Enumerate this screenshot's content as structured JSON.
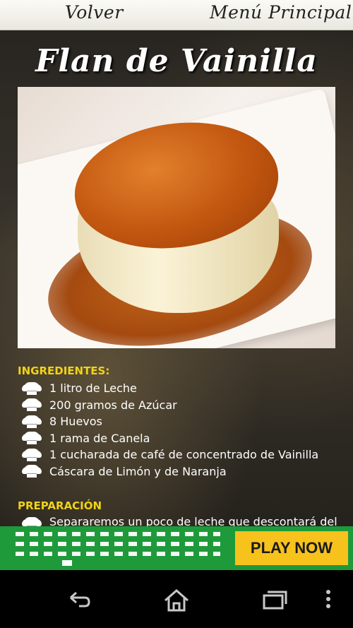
{
  "header": {
    "back_label": "Volver",
    "menu_label": "Menú Principal"
  },
  "recipe": {
    "title": "Flan de Vainilla",
    "photo_icon": "flan-photo",
    "ingredients_heading": "INGREDIENTES:",
    "ingredients": [
      "1 litro de Leche",
      "200 gramos de Azúcar",
      "8 Huevos",
      "1 rama de Canela",
      "1 cucharada de café de concentrado de Vainilla",
      "Cáscara de Limón y de Naranja"
    ],
    "preparation_heading": "PREPARACIÓN",
    "preparation_first_line": "Separaremos un poco de leche que descontará del"
  },
  "ad": {
    "cta_label": "PLAY NOW",
    "background_color": "#1e9a3a",
    "cta_color": "#f7c21c"
  },
  "system_nav": {
    "back_icon": "back-icon",
    "home_icon": "home-icon",
    "recents_icon": "recents-icon",
    "more_icon": "more-icon"
  }
}
